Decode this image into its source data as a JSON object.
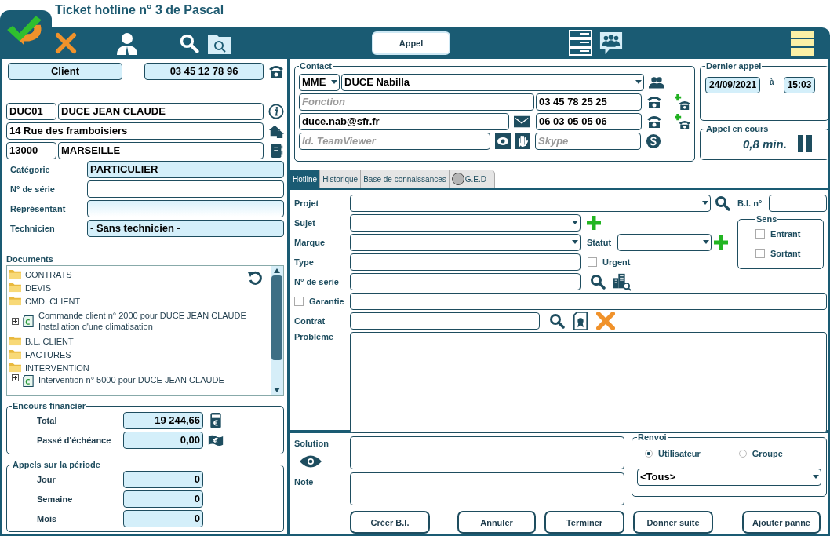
{
  "window": {
    "title": "Ticket hotline n° 3 de Pascal"
  },
  "toolbar": {
    "center_button": "Appel"
  },
  "client": {
    "label": "Client",
    "phone": "03 45 12 78 96",
    "code": "DUC01",
    "name": "DUCE JEAN CLAUDE",
    "address": "14 Rue des framboisiers",
    "postcode": "13000",
    "city": "MARSEILLE",
    "fields": [
      {
        "label": "Catégorie",
        "value": "PARTICULIER",
        "kind": "filled"
      },
      {
        "label": "N° de série",
        "kind": "blank"
      },
      {
        "label": "Représentant",
        "kind": "blank"
      },
      {
        "label": "Technicien",
        "value": "- Sans technicien -",
        "kind": "filled"
      }
    ]
  },
  "documents": {
    "title": "Documents",
    "items": [
      {
        "kind": "folder",
        "label": "CONTRATS"
      },
      {
        "kind": "folder",
        "label": "DEVIS"
      },
      {
        "kind": "folder",
        "label": "CMD. CLIENT"
      },
      {
        "kind": "document",
        "lines": [
          "Commande client n° 2000 pour DUCE JEAN CLAUDE",
          "Installation d'une climatisation"
        ]
      },
      {
        "kind": "folder",
        "label": "B.L. CLIENT"
      },
      {
        "kind": "folder",
        "label": "FACTURES"
      },
      {
        "kind": "folder",
        "label": "INTERVENTION"
      },
      {
        "kind": "document",
        "lines": [
          "Intervention n° 5000 pour DUCE JEAN CLAUDE"
        ]
      }
    ]
  },
  "encours": {
    "title": "Encours financier",
    "rows": [
      {
        "label": "Total",
        "value": "19 244,66"
      },
      {
        "label": "Passé d'échéance",
        "value": "0,00"
      }
    ]
  },
  "appels": {
    "title": "Appels sur la période",
    "rows": [
      {
        "label": "Jour",
        "value": "0"
      },
      {
        "label": "Semaine",
        "value": "0"
      },
      {
        "label": "Mois",
        "value": "0"
      }
    ]
  },
  "contact": {
    "title": "Contact",
    "civility": "MME",
    "name": "DUCE Nabilla",
    "function_placeholder": "Fonction",
    "phone": "03 45 78 25 25",
    "email": "duce.nab@sfr.fr",
    "mobile": "06 03 05 05 06",
    "teamviewer_placeholder": "Id. TeamViewer",
    "skype_placeholder": "Skype"
  },
  "last_call": {
    "title": "Dernier appel",
    "date": "24/09/2021",
    "at": "à",
    "time": "15:03"
  },
  "current_call": {
    "title": "Appel en cours",
    "duration": "0,8 min."
  },
  "tabs": [
    {
      "label": "Hotline",
      "selected": true
    },
    {
      "label": "Historique",
      "selected": false
    },
    {
      "label": "Base de connaissances",
      "selected": false
    },
    {
      "label": "G.E.D",
      "selected": false
    }
  ],
  "form": {
    "projet": "Projet",
    "bi_label": "B.I. n°",
    "sujet": "Sujet",
    "marque": "Marque",
    "statut": "Statut",
    "type": "Type",
    "urgent": {
      "label": "Urgent",
      "checked": false
    },
    "serie": "N° de serie",
    "garantie": {
      "label": "Garantie",
      "checked": false
    },
    "contrat": "Contrat",
    "probleme": "Problème"
  },
  "sens": {
    "title": "Sens",
    "options": [
      {
        "label": "Entrant",
        "checked": false
      },
      {
        "label": "Sortant",
        "checked": false
      }
    ]
  },
  "solution": {
    "solution_label": "Solution",
    "note_label": "Note"
  },
  "renvoi": {
    "title": "Renvoi",
    "options": [
      {
        "label": "Utilisateur",
        "selected": true
      },
      {
        "label": "Groupe",
        "selected": false
      }
    ],
    "value": "<Tous>"
  },
  "buttons": [
    "Créer B.I.",
    "Annuler",
    "Terminer",
    "Donner suite",
    "Ajouter panne"
  ]
}
